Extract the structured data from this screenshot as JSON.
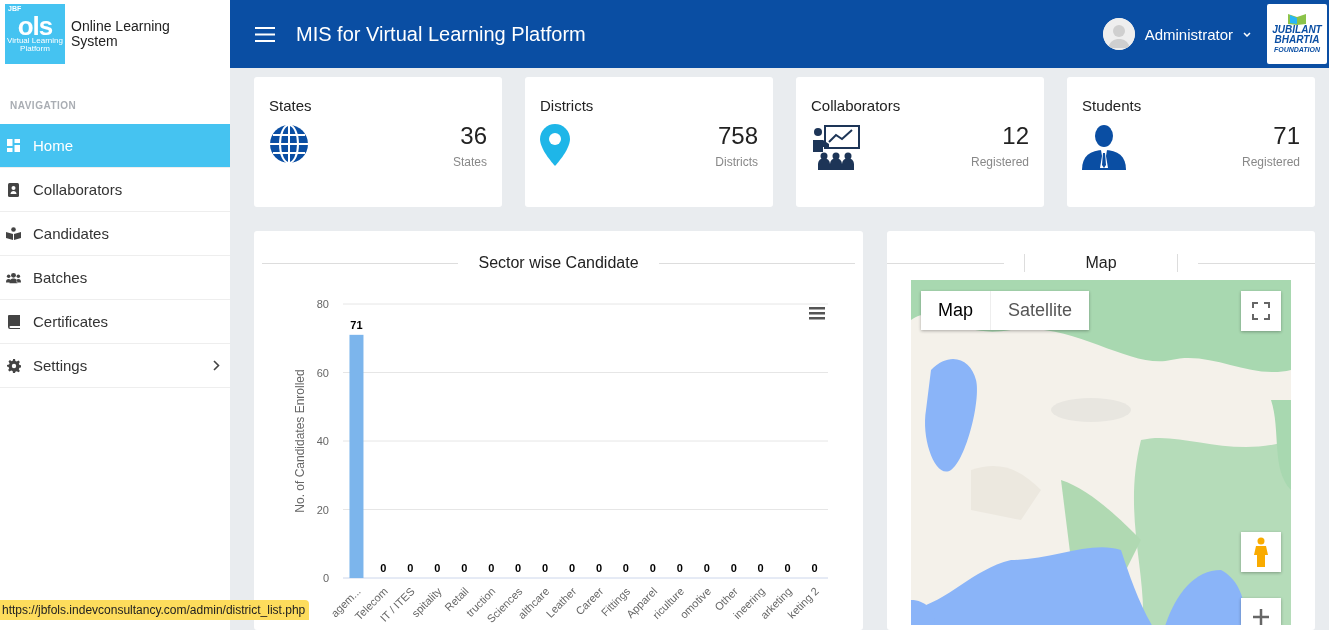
{
  "sidebar": {
    "logo": {
      "badge": "JBF",
      "wordmark": "ols",
      "tagline": "Virtual Learning Platform"
    },
    "app_name": "Online Learning System",
    "section": "NAVIGATION",
    "items": [
      {
        "label": "Home",
        "selected": true,
        "submenu": false
      },
      {
        "label": "Collaborators",
        "selected": false,
        "submenu": false
      },
      {
        "label": "Candidates",
        "selected": false,
        "submenu": false
      },
      {
        "label": "Batches",
        "selected": false,
        "submenu": false
      },
      {
        "label": "Certificates",
        "selected": false,
        "submenu": false
      },
      {
        "label": "Settings",
        "selected": false,
        "submenu": true
      }
    ]
  },
  "top_bar": {
    "title": "MIS for Virtual Learning Platform",
    "user": "Administrator",
    "partner_logo": [
      "JUBILANT",
      "BHARTIA",
      "FOUNDATION"
    ]
  },
  "stats": [
    {
      "title": "States",
      "value": "36",
      "caption": "States"
    },
    {
      "title": "Districts",
      "value": "758",
      "caption": "Districts"
    },
    {
      "title": "Collaborators",
      "value": "12",
      "caption": "Registered"
    },
    {
      "title": "Students",
      "value": "71",
      "caption": "Registered"
    }
  ],
  "sector_chart": {
    "title": "Sector wise Candidate",
    "chart_data": {
      "type": "bar",
      "ylabel": "No. of Candidates Enrolled",
      "categories": [
        "agem...",
        "Telecom",
        "IT / ITES",
        "spitality",
        "Retail",
        "truction",
        "Sciences",
        "althcare",
        "Leather",
        "Career",
        "Fittings",
        "Apparel",
        "riculture",
        "omotive",
        "Other",
        "ineering",
        "arketing",
        "keting 2"
      ],
      "series": [
        {
          "color": "#7cb5ec",
          "values": [
            71,
            0,
            0,
            0,
            0,
            0,
            0,
            0,
            0,
            0,
            0,
            0,
            0,
            0,
            0,
            0,
            0,
            0
          ]
        }
      ],
      "ylim": [
        0,
        80
      ],
      "yticks": [
        0,
        20,
        40,
        60,
        80
      ],
      "grid": true,
      "data_labels": true
    }
  },
  "map": {
    "title": "Map",
    "map_types": [
      {
        "label": "Map",
        "selected": true
      },
      {
        "label": "Satellite",
        "selected": false
      }
    ]
  },
  "status_tip": "https://jbfols.indevconsultancy.com/admin/district_list.php"
}
